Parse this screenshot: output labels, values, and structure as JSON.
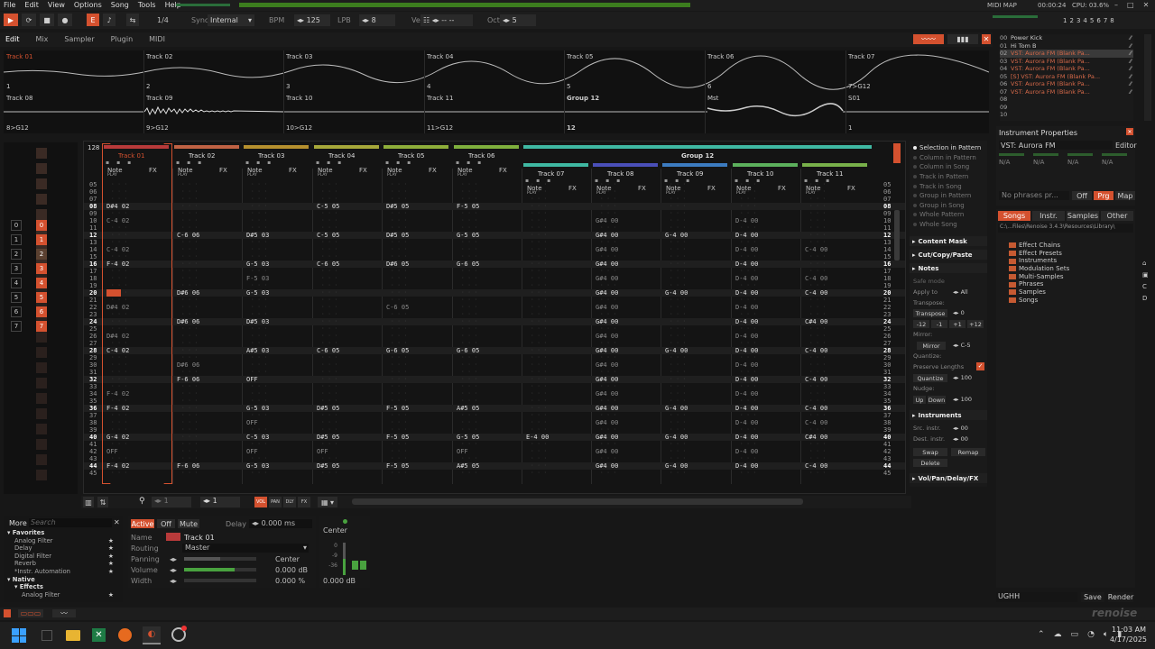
{
  "menu": [
    "File",
    "Edit",
    "View",
    "Options",
    "Song",
    "Tools",
    "Help"
  ],
  "transport": {
    "sync_label": "Sync",
    "sync_value": "Internal",
    "bpm_label": "BPM",
    "bpm": "125",
    "lpb_label": "LPB",
    "lpb": "8",
    "vel_label": "Vel",
    "vel": "-- --",
    "oct_label": "Oct",
    "oct": "5",
    "pattern_ratio": "1/4"
  },
  "status": {
    "midi": "MIDI MAP",
    "time": "00:00:24",
    "cpu": "CPU: 03.6%"
  },
  "view_tabs": [
    "Edit",
    "Mix",
    "Sampler",
    "Plugin",
    "MIDI"
  ],
  "scopes": {
    "row1": [
      {
        "name": "Track 01",
        "num": "1"
      },
      {
        "name": "Track 02",
        "num": "2"
      },
      {
        "name": "Track 03",
        "num": "3"
      },
      {
        "name": "Track 04",
        "num": "4"
      },
      {
        "name": "Track 05",
        "num": "5"
      },
      {
        "name": "Track 06",
        "num": "6"
      },
      {
        "name": "Track 07",
        "num": "7>G12"
      }
    ],
    "row2": [
      {
        "name": "Track 08",
        "num": "8>G12"
      },
      {
        "name": "Track 09",
        "num": "9>G12"
      },
      {
        "name": "Track 10",
        "num": "10>G12"
      },
      {
        "name": "Track 11",
        "num": "11>G12"
      },
      {
        "name": "Group 12",
        "num": "12"
      },
      {
        "name": "Mst",
        "num": ""
      },
      {
        "name": "S01",
        "num": "1"
      }
    ]
  },
  "instruments": [
    {
      "idx": "00",
      "name": "Power Kick"
    },
    {
      "idx": "01",
      "name": "Hi Tom B"
    },
    {
      "idx": "02",
      "name": "VST: Aurora FM (Blank Pa..."
    },
    {
      "idx": "03",
      "name": "VST: Aurora FM (Blank Pa..."
    },
    {
      "idx": "04",
      "name": "VST: Aurora FM (Blank Pa..."
    },
    {
      "idx": "05",
      "name": "[S] VST: Aurora FM (Blank Pa..."
    },
    {
      "idx": "06",
      "name": "VST: Aurora FM (Blank Pa..."
    },
    {
      "idx": "07",
      "name": "VST: Aurora FM (Blank Pa..."
    },
    {
      "idx": "08",
      "name": ""
    },
    {
      "idx": "09",
      "name": ""
    },
    {
      "idx": "10",
      "name": ""
    }
  ],
  "inst_props": {
    "title": "Instrument Properties",
    "name": "VST: Aurora FM",
    "editor": "Editor",
    "na": [
      "N/A",
      "N/A",
      "N/A",
      "N/A"
    ],
    "phrases": "No phrases pr...",
    "off": "Off",
    "prg": "Prg",
    "map": "Map"
  },
  "browser": {
    "tabs": [
      "Songs",
      "Instr.",
      "Samples",
      "Other"
    ],
    "path": "C:\\...Files\\Renoise 3.4.3\\Resources\\Library\\",
    "folders": [
      "Effect Chains",
      "Effect Presets",
      "Instruments",
      "Modulation Sets",
      "Multi-Samples",
      "Phrases",
      "Samples",
      "Songs"
    ]
  },
  "bottom_right": {
    "filename": "UGHH",
    "save": "Save",
    "render": "Render"
  },
  "pattern": {
    "num": "128",
    "group_label": "Group 12",
    "tracks": [
      "Track 01",
      "Track 02",
      "Track 03",
      "Track 04",
      "Track 05",
      "Track 06"
    ],
    "group_tracks": [
      "Track 07",
      "Track 08",
      "Track 09",
      "Track 10",
      "Track 11"
    ],
    "col_note": "Note",
    "col_fx": "FX",
    "play": "PLAY",
    "rows": [
      "05",
      "06",
      "07",
      "08",
      "09",
      "10",
      "11",
      "12",
      "13",
      "14",
      "15",
      "16",
      "17",
      "18",
      "19",
      "20",
      "21",
      "22",
      "23",
      "24",
      "25",
      "26",
      "27",
      "28",
      "29",
      "30",
      "31",
      "32",
      "33",
      "34",
      "35",
      "36",
      "37",
      "38",
      "39",
      "40",
      "41",
      "42",
      "43",
      "44",
      "45"
    ],
    "notes": [
      [
        "",
        "",
        "",
        "D#4 02",
        "",
        "C-4 02",
        "",
        "",
        "",
        "C-4 02",
        "",
        "F-4 02",
        "",
        "",
        "",
        "",
        "",
        "D#4 02",
        "",
        "",
        "",
        "D#4 02",
        "",
        "C-4 02",
        "",
        "",
        "",
        "",
        "",
        "F-4 02",
        "",
        "F-4 02",
        "",
        "",
        "",
        "G-4 02",
        "",
        "OFF",
        "",
        "F-4 02",
        ""
      ],
      [
        "",
        "",
        "",
        "",
        "",
        "",
        "",
        "C-6 06",
        "",
        "",
        "",
        "",
        "",
        "",
        "",
        "D#6 06",
        "",
        "",
        "",
        "D#6 06",
        "",
        "",
        "",
        "",
        "",
        "D#6 06",
        "",
        "F-6 06",
        "",
        "",
        "",
        "",
        "",
        "",
        "",
        "",
        "",
        "",
        "",
        "F-6 06",
        ""
      ],
      [
        "",
        "",
        "",
        "",
        "",
        "",
        "",
        "D#5 03",
        "",
        "",
        "",
        "G-5 03",
        "",
        "F-5 03",
        "",
        "G-5 03",
        "",
        "",
        "",
        "D#5 03",
        "",
        "",
        "",
        "A#5 03",
        "",
        "",
        "",
        "OFF",
        "",
        "",
        "",
        "G-5 03",
        "",
        "OFF",
        "",
        "C-5 03",
        "",
        "OFF",
        "",
        "G-5 03",
        ""
      ],
      [
        "",
        "",
        "",
        "C-5 05",
        "",
        "",
        "",
        "C-5 05",
        "",
        "",
        "",
        "C-6 05",
        "",
        "",
        "",
        "",
        "",
        "",
        "",
        "",
        "",
        "",
        "",
        "C-6 05",
        "",
        "",
        "",
        "",
        "",
        "",
        "",
        "D#5 05",
        "",
        "",
        "",
        "D#5 05",
        "",
        "OFF",
        "",
        "D#5 05",
        ""
      ],
      [
        "",
        "",
        "",
        "D#5 05",
        "",
        "",
        "",
        "D#5 05",
        "",
        "",
        "",
        "D#6 05",
        "",
        "",
        "",
        "",
        "",
        "C-6 05",
        "",
        "",
        "",
        "",
        "",
        "G-6 05",
        "",
        "",
        "",
        "",
        "",
        "",
        "",
        "F-5 05",
        "",
        "",
        "",
        "F-5 05",
        "",
        "",
        "",
        "F-5 05",
        ""
      ],
      [
        "",
        "",
        "",
        "F-5 05",
        "",
        "",
        "",
        "G-5 05",
        "",
        "",
        "",
        "G-6 05",
        "",
        "",
        "",
        "",
        "",
        "",
        "",
        "",
        "",
        "",
        "",
        "G-6 05",
        "",
        "",
        "",
        "",
        "",
        "",
        "",
        "A#5 05",
        "",
        "",
        "",
        "G-5 05",
        "",
        "OFF",
        "",
        "A#5 05",
        ""
      ],
      [
        "",
        "",
        "",
        "",
        "",
        "",
        "",
        "",
        "",
        "",
        "",
        "",
        "",
        "",
        "",
        "",
        "",
        "",
        "",
        "",
        "",
        "",
        "",
        "",
        "",
        "",
        "",
        "",
        "",
        "",
        "",
        "",
        "",
        "",
        "",
        "E-4 00",
        "",
        "",
        "",
        "",
        ""
      ],
      [
        "",
        "",
        "",
        "",
        "",
        "G#4 00",
        "",
        "G#4 00",
        "",
        "G#4 00",
        "",
        "G#4 00",
        "",
        "G#4 00",
        "",
        "G#4 00",
        "",
        "G#4 00",
        "",
        "G#4 00",
        "",
        "G#4 00",
        "",
        "G#4 00",
        "",
        "G#4 00",
        "",
        "G#4 00",
        "",
        "G#4 00",
        "",
        "G#4 00",
        "",
        "G#4 00",
        "",
        "G#4 00",
        "",
        "G#4 00",
        "",
        "G#4 00",
        ""
      ],
      [
        "",
        "",
        "",
        "",
        "",
        "",
        "",
        "G-4 00",
        "",
        "",
        "",
        "",
        "",
        "",
        "",
        "G-4 00",
        "",
        "",
        "",
        "",
        "",
        "",
        "",
        "G-4 00",
        "",
        "",
        "",
        "",
        "",
        "",
        "",
        "G-4 00",
        "",
        "",
        "",
        "G-4 00",
        "",
        "",
        "",
        "G-4 00",
        ""
      ],
      [
        "",
        "",
        "",
        "",
        "",
        "D-4 00",
        "",
        "D-4 00",
        "",
        "D-4 00",
        "",
        "D-4 00",
        "",
        "D-4 00",
        "",
        "D-4 00",
        "",
        "D-4 00",
        "",
        "D-4 00",
        "",
        "D-4 00",
        "",
        "D-4 00",
        "",
        "D-4 00",
        "",
        "D-4 00",
        "",
        "D-4 00",
        "",
        "D-4 00",
        "",
        "D-4 00",
        "",
        "D-4 00",
        "",
        "D-4 00",
        "",
        "D-4 00",
        ""
      ],
      [
        "",
        "",
        "",
        "",
        "",
        "",
        "",
        "",
        "",
        "C-4 00",
        "",
        "",
        "",
        "C-4 00",
        "",
        "C-4 00",
        "",
        "",
        "",
        "C#4 00",
        "",
        "",
        "",
        "C-4 00",
        "",
        "",
        "",
        "C-4 00",
        "",
        "",
        "",
        "C-4 00",
        "",
        "C-4 00",
        "",
        "C#4 00",
        "",
        "",
        "",
        "C-4 00",
        ""
      ]
    ]
  },
  "right_panel": {
    "selection": [
      "Selection in Pattern",
      "Column in Pattern",
      "Column in Song",
      "Track in Pattern",
      "Track in Song",
      "Group in Pattern",
      "Group in Song",
      "Whole Pattern",
      "Whole Song"
    ],
    "sections": [
      "Content Mask",
      "Cut/Copy/Paste",
      "Notes",
      "Instruments",
      "Vol/Pan/Delay/FX"
    ],
    "safe_mode": "Safe mode",
    "apply_to": "Apply to",
    "apply_val": "All",
    "transpose_label": "Transpose:",
    "transpose_btn": "Transpose",
    "transpose_val": "0",
    "transpose_steps": [
      "-12",
      "-1",
      "+1",
      "+12"
    ],
    "mirror_label": "Mirror:",
    "mirror_btn": "Mirror",
    "mirror_val": "C-5",
    "quantize_label": "Quantize:",
    "preserve": "Preserve Lengths",
    "quantize_btn": "Quantize",
    "quantize_val": "100",
    "nudge_label": "Nudge:",
    "up": "Up",
    "down": "Down",
    "nudge_val": "100",
    "src": "Src. instr.",
    "src_val": "00",
    "dest": "Dest. instr.",
    "dest_val": "00",
    "swap": "Swap",
    "remap": "Remap",
    "delete": "Delete"
  },
  "pattern_matrix": {
    "numbers": [
      "0",
      "1",
      "2",
      "3",
      "4",
      "5",
      "6",
      "7"
    ]
  },
  "lower_toolbar": {
    "step": "1",
    "edit_step": "1",
    "modes": [
      "VOL",
      "PAN",
      "DLY",
      "FX"
    ]
  },
  "dsp": {
    "more": "More",
    "search_placeholder": "Search",
    "tree": [
      {
        "t": "Favorites",
        "l": 0,
        "star": false,
        "hdr": true
      },
      {
        "t": "Analog Filter",
        "l": 1,
        "star": true
      },
      {
        "t": "Delay",
        "l": 1,
        "star": true
      },
      {
        "t": "Digital Filter",
        "l": 1,
        "star": true
      },
      {
        "t": "Reverb",
        "l": 1,
        "star": true
      },
      {
        "t": "*Instr. Automation",
        "l": 1,
        "star": true
      },
      {
        "t": "Native",
        "l": 0,
        "star": false,
        "hdr": true
      },
      {
        "t": "Effects",
        "l": 1,
        "star": false,
        "hdr": true
      },
      {
        "t": "Analog Filter",
        "l": 2,
        "star": true
      }
    ]
  },
  "track_dsp": {
    "active": "Active",
    "off": "Off",
    "mute": "Mute",
    "delay_label": "Delay",
    "delay_val": "0.000 ms",
    "name_label": "Name",
    "name_val": "Track 01",
    "routing_label": "Routing",
    "routing_val": "Master",
    "panning_label": "Panning",
    "panning_val": "Center",
    "volume_label": "Volume",
    "volume_val": "0.000 dB",
    "width_label": "Width",
    "width_val": "0.000 %",
    "volume_level": 0.7,
    "panning_level": 0.5
  },
  "meter": {
    "center": "Center",
    "db": "0.000 dB",
    "ticks": [
      "0",
      "-9",
      "-36"
    ]
  },
  "taskbar": {
    "time": "11:03 AM",
    "date": "4/17/2025"
  },
  "logo": "renoise",
  "colors": {
    "accent": "#d4512f",
    "track1": "#b83a3a",
    "track2": "#c06244",
    "track3": "#b6902e",
    "track4": "#a7a83a",
    "track5": "#8eae3a",
    "track6": "#7fb03d",
    "group": "#3fb8a2",
    "g7": "#3fb8a2",
    "g8": "#4a4fb8",
    "g9": "#3c7bc0",
    "g10": "#5cb05c",
    "g11": "#78b04a"
  }
}
